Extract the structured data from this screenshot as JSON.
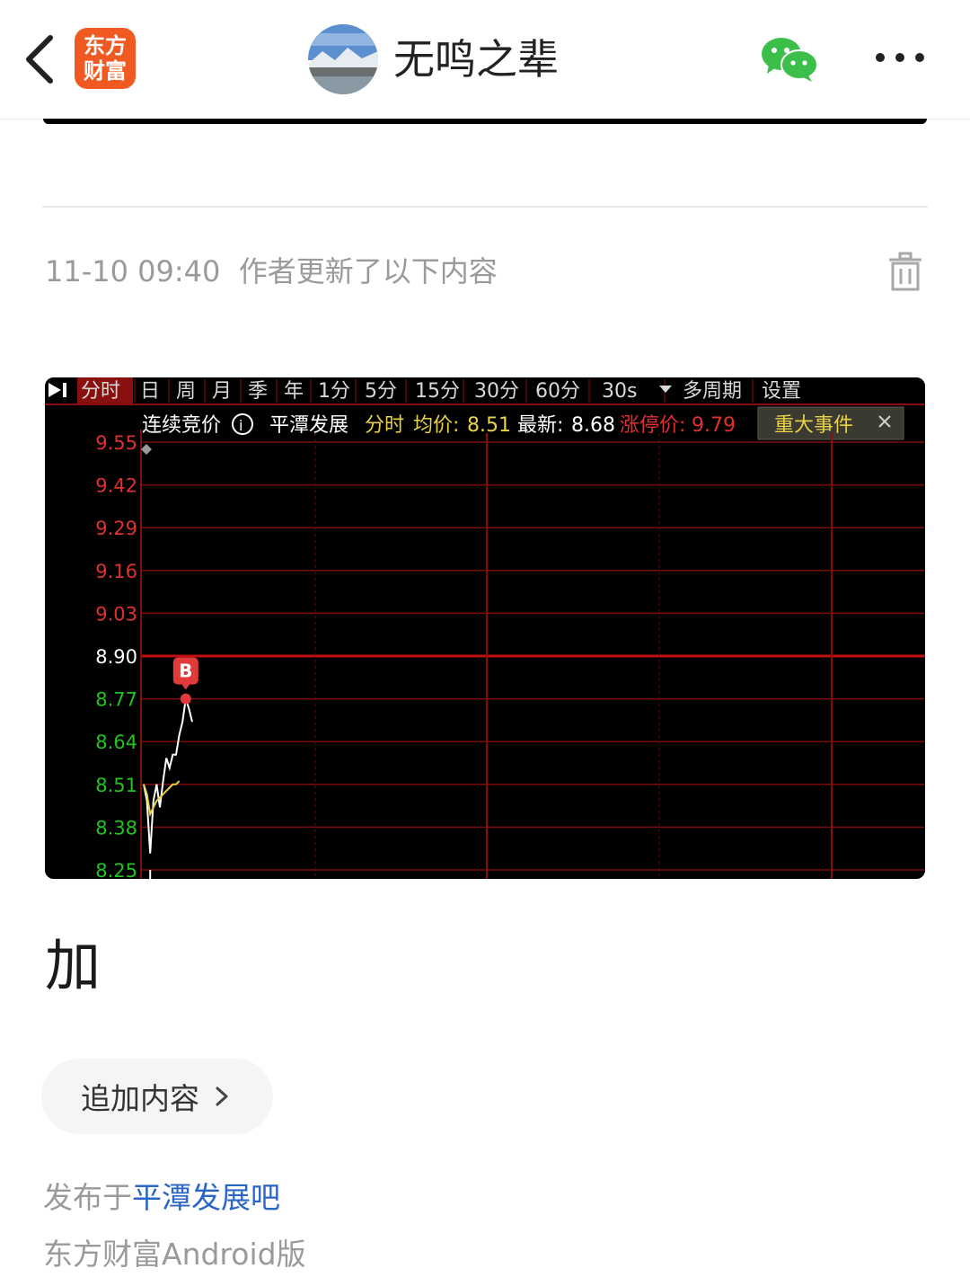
{
  "header": {
    "app_logo_line1": "东方",
    "app_logo_line2": "财富",
    "author_name": "无鸣之辈",
    "icons": [
      "back-icon",
      "wechat-icon",
      "more-icon"
    ]
  },
  "update": {
    "timestamp": "11-10 09:40",
    "label": "作者更新了以下内容"
  },
  "stock_chart": {
    "tabs": [
      "分时",
      "日",
      "周",
      "月",
      "季",
      "年",
      "1分",
      "5分",
      "15分",
      "30分",
      "60分",
      "30s",
      "多周期",
      "设置"
    ],
    "info": {
      "auction": "连续竞价",
      "stock_name": "平潭发展",
      "mode": "分时",
      "avg_label": "均价:",
      "avg_value": "8.51",
      "latest_label": "最新:",
      "latest_value": "8.68",
      "limit_label": "涨停价:",
      "limit_value": "9.79",
      "event_label": "重大事件"
    },
    "marker": "B",
    "colors": {
      "up": "#e03030",
      "down": "#22c222",
      "neutral": "#ffffff",
      "grid": "#8a0d0d",
      "label_yellow": "#e8d24a"
    }
  },
  "chart_data": {
    "type": "line",
    "y_ticks": [
      "9.55",
      "9.42",
      "9.29",
      "9.16",
      "9.03",
      "8.90",
      "8.77",
      "8.64",
      "8.51",
      "8.38",
      "8.25"
    ],
    "ylim": [
      8.25,
      9.55
    ],
    "reference_price": 8.9,
    "series": [
      {
        "name": "",
        "color": "#ffffff",
        "points": [
          [
            0,
            8.51
          ],
          [
            1,
            8.46
          ],
          [
            2,
            8.3
          ],
          [
            3,
            8.46
          ],
          [
            4,
            8.51
          ],
          [
            5,
            8.44
          ],
          [
            6,
            8.52
          ],
          [
            7,
            8.59
          ],
          [
            8,
            8.56
          ],
          [
            9,
            8.6
          ],
          [
            10,
            8.6
          ],
          [
            11,
            8.66
          ],
          [
            12,
            8.7
          ],
          [
            13,
            8.77
          ],
          [
            14,
            8.74
          ],
          [
            15,
            8.7
          ]
        ]
      },
      {
        "name": "",
        "color": "#e8d24a",
        "points": [
          [
            0,
            8.51
          ],
          [
            1,
            8.48
          ],
          [
            2,
            8.42
          ],
          [
            3,
            8.44
          ],
          [
            4,
            8.46
          ],
          [
            5,
            8.47
          ],
          [
            6,
            8.48
          ],
          [
            7,
            8.49
          ],
          [
            8,
            8.5
          ],
          [
            9,
            8.51
          ],
          [
            10,
            8.51
          ],
          [
            11,
            8.52
          ]
        ]
      }
    ],
    "marker_point": [
      13,
      8.77
    ]
  },
  "content": {
    "text": "加"
  },
  "actions": {
    "append_label": "追加内容"
  },
  "footer": {
    "published_prefix": "发布于",
    "bar_name": "平潭发展吧",
    "client": "东方财富Android版"
  }
}
